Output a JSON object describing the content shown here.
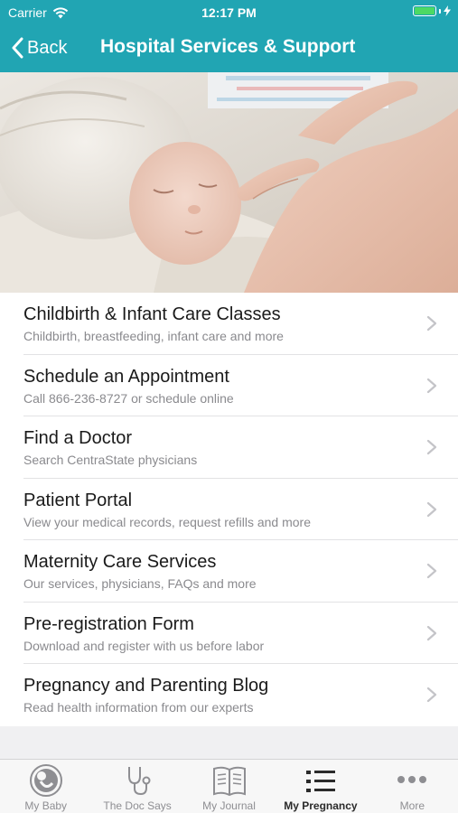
{
  "status_bar": {
    "carrier": "Carrier",
    "time": "12:17 PM",
    "wifi_icon": "wifi-icon",
    "battery_icon": "battery-icon",
    "battery_level": 1.0
  },
  "nav": {
    "back_label": "Back",
    "title": "Hospital Services & Support"
  },
  "colors": {
    "nav_bg": "#21a5b3",
    "list_bg": "#ffffff",
    "page_bg": "#f0f0f2",
    "battery_fill": "#4cd964"
  },
  "hero": {
    "icon": "newborn-baby-photo"
  },
  "list": {
    "items": [
      {
        "title": "Childbirth & Infant Care Classes",
        "subtitle": "Childbirth, breastfeeding, infant care and more"
      },
      {
        "title": "Schedule an Appointment",
        "subtitle": "Call 866-236-8727 or schedule online"
      },
      {
        "title": "Find a Doctor",
        "subtitle": "Search CentraState physicians"
      },
      {
        "title": "Patient Portal",
        "subtitle": "View your medical records, request refills and more"
      },
      {
        "title": "Maternity Care Services",
        "subtitle": "Our services, physicians, FAQs and more"
      },
      {
        "title": "Pre-registration Form",
        "subtitle": "Download and register with us before labor"
      },
      {
        "title": "Pregnancy and Parenting Blog",
        "subtitle": "Read health information from our experts"
      }
    ]
  },
  "tabs": [
    {
      "label": "My Baby",
      "icon": "baby-icon",
      "active": false
    },
    {
      "label": "The Doc Says",
      "icon": "stethoscope-icon",
      "active": false
    },
    {
      "label": "My Journal",
      "icon": "journal-icon",
      "active": false
    },
    {
      "label": "My Pregnancy",
      "icon": "list-icon",
      "active": true
    },
    {
      "label": "More",
      "icon": "more-icon",
      "active": false
    }
  ]
}
